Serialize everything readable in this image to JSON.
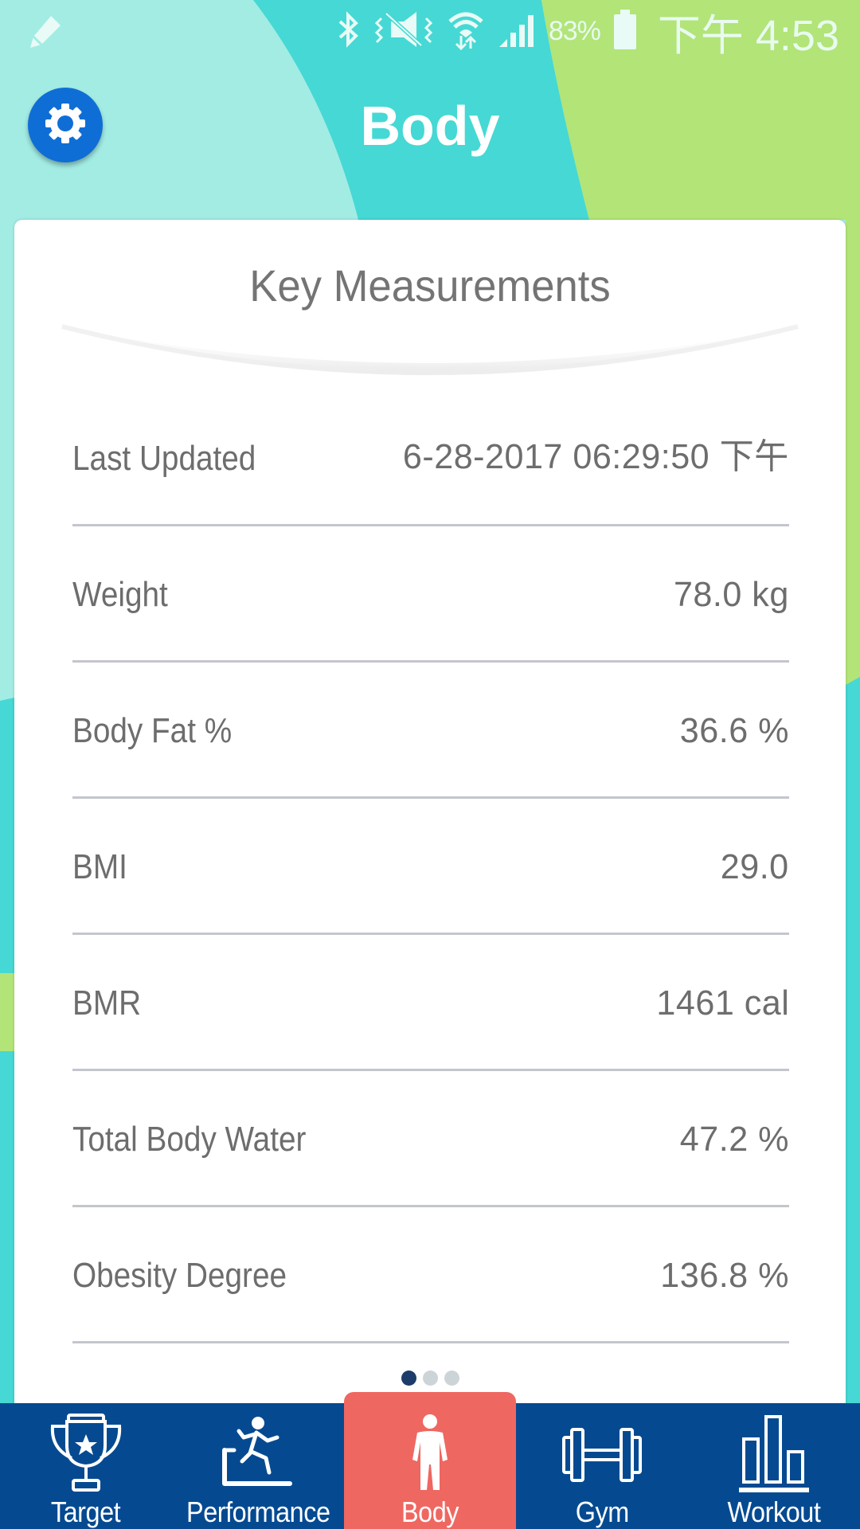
{
  "status_bar": {
    "battery_percent": "83%",
    "time": "下午 4:53",
    "icons": [
      "pencil-icon",
      "bluetooth-icon",
      "vibrate-mute-icon",
      "wifi-icon",
      "signal-icon",
      "battery-icon"
    ]
  },
  "header": {
    "title": "Body",
    "settings_icon": "gear-icon"
  },
  "colors": {
    "bg_light_teal": "#a2ece4",
    "bg_teal": "#46d8d4",
    "bg_green": "#b2e478",
    "settings_blue": "#0f6ed6",
    "tabbar_blue": "#054a91",
    "active_tab": "#ef6761",
    "text_gray": "#6d6d6d"
  },
  "card": {
    "title": "Key Measurements",
    "rows": [
      {
        "label": "Last Updated",
        "value": "6-28-2017 06:29:50 下午"
      },
      {
        "label": "Weight",
        "value": "78.0 kg"
      },
      {
        "label": "Body Fat %",
        "value": "36.6 %"
      },
      {
        "label": "BMI",
        "value": "29.0"
      },
      {
        "label": "BMR",
        "value": "1461 cal"
      },
      {
        "label": "Total Body Water",
        "value": "47.2 %"
      },
      {
        "label": "Obesity Degree",
        "value": "136.8 %"
      }
    ],
    "pager": {
      "total": 3,
      "current": 1
    }
  },
  "tabs": [
    {
      "label": "Target",
      "icon": "trophy-icon",
      "active": false
    },
    {
      "label": "Performance",
      "icon": "treadmill-runner-icon",
      "active": false
    },
    {
      "label": "Body",
      "icon": "person-icon",
      "active": true
    },
    {
      "label": "Gym",
      "icon": "dumbbell-icon",
      "active": false
    },
    {
      "label": "Workout",
      "icon": "bar-chart-icon",
      "active": false
    }
  ]
}
